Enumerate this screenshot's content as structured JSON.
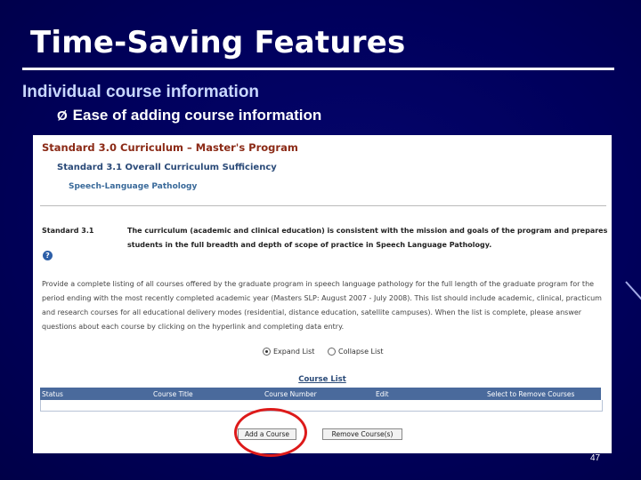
{
  "slide": {
    "title": "Time-Saving Features",
    "subheading": "Individual course information",
    "bullet_marker": "Ø",
    "bullet": "Ease of adding course information",
    "page_number": "47"
  },
  "screenshot": {
    "heading_standard": "Standard 3.0 Curriculum – Master's Program",
    "heading_substandard": "Standard 3.1 Overall Curriculum Sufficiency",
    "heading_program": "Speech-Language Pathology",
    "standard_label": "Standard 3.1",
    "standard_text": "The curriculum (academic and clinical education) is consistent with the mission and goals of the program and prepares students in the full breadth and depth of scope of practice in Speech Language Pathology.",
    "help_icon": "?",
    "instructions": "Provide a complete listing of all courses offered by the graduate program in speech language pathology for the full length of the graduate program for the period ending with the most recently completed academic year (Masters SLP: August 2007 - July 2008). This list should include academic, clinical, practicum and research courses for all educational delivery modes (residential, distance education, satellite campuses). When the list is complete, please answer questions about each course by clicking on the hyperlink and completing data entry.",
    "radio_expand": "Expand List",
    "radio_collapse": "Collapse List",
    "selected_radio": "Expand List",
    "course_list_title": "Course List",
    "table_columns": [
      "Status",
      "Course Title",
      "Course Number",
      "Edit",
      "Select to Remove Courses"
    ],
    "add_button": "Add a Course",
    "remove_button": "Remove Course(s)"
  },
  "colors": {
    "slide_background": "#00005a",
    "title_text": "#ffffff",
    "subheading_text": "#c9d8ff",
    "heading_brown": "#8b2a16",
    "heading_blue": "#2a4a78",
    "table_header": "#4a6a9c",
    "highlight_circle": "#dd1a1a"
  }
}
